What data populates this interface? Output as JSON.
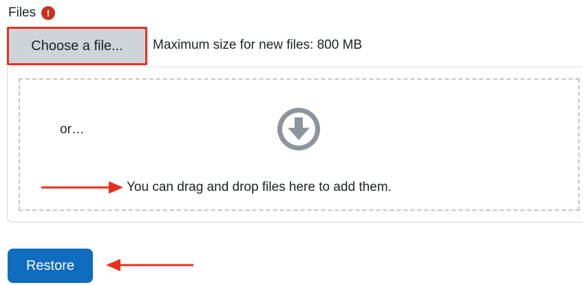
{
  "form": {
    "files_label": "Files",
    "required_icon_glyph": "!",
    "required_icon": "exclamation-circle-icon",
    "required_color": "#ca3120"
  },
  "filepicker": {
    "choose_label": "Choose a file...",
    "max_size_text": "Maximum size for new files: 800 MB",
    "highlight_color": "#e8301d"
  },
  "dropzone": {
    "or_text": "or…",
    "icon": "download-circle-icon",
    "drop_text": "You can drag and drop files here to add them."
  },
  "actions": {
    "restore_label": "Restore",
    "restore_color": "#0f6cbf"
  },
  "annotations": {
    "arrow_color": "#e8301d"
  }
}
